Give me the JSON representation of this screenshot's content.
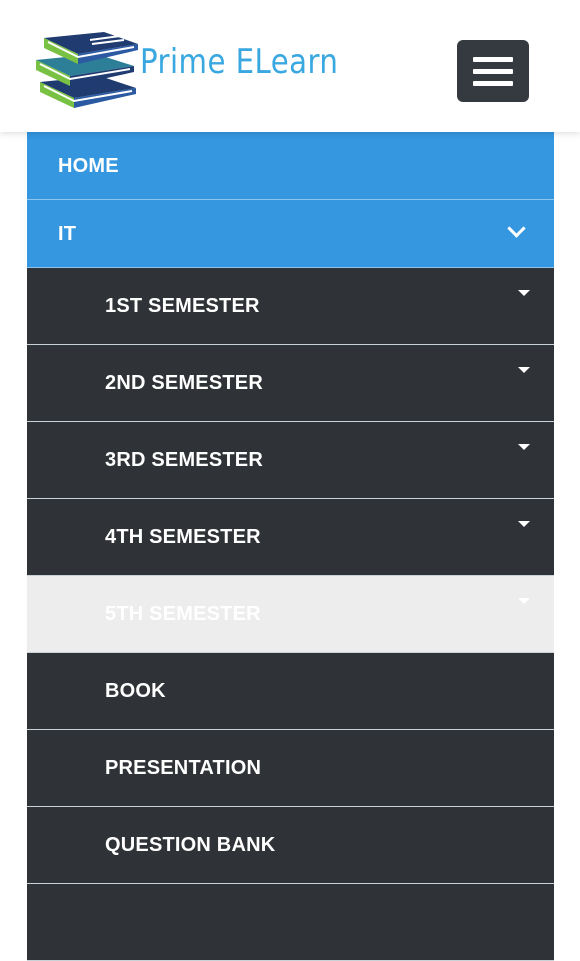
{
  "header": {
    "logo_text": "Prime ELearn",
    "menu_toggle_icon": "hamburger-icon"
  },
  "nav": {
    "home_label": "HOME",
    "it": {
      "label": "IT",
      "expand_icon": "chevron-down-icon"
    },
    "sub_items": [
      {
        "label": "1ST SEMESTER",
        "has_dropdown": true
      },
      {
        "label": "2ND SEMESTER",
        "has_dropdown": true
      },
      {
        "label": "3RD SEMESTER",
        "has_dropdown": true
      },
      {
        "label": "4TH SEMESTER",
        "has_dropdown": true
      },
      {
        "label": "5TH SEMESTER",
        "has_dropdown": true,
        "state": "hover"
      },
      {
        "label": "BOOK",
        "has_dropdown": false
      },
      {
        "label": "PRESENTATION",
        "has_dropdown": false
      },
      {
        "label": "QUESTION BANK",
        "has_dropdown": false
      }
    ]
  },
  "colors": {
    "primary_blue": "#3497e0",
    "dark_item": "#2f3236",
    "hover_item": "#ededed",
    "logo_blue": "#39a7e0",
    "logo_green": "#79c143",
    "logo_navy": "#1f3b70",
    "toggle_bg": "#343a40"
  }
}
